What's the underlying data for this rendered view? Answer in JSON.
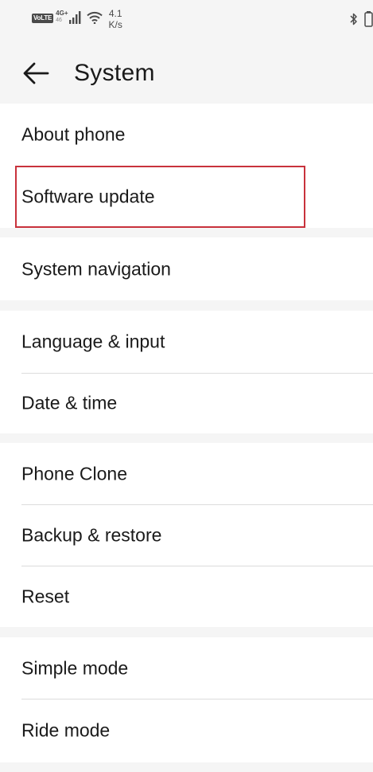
{
  "status_bar": {
    "volte": "VoLTE",
    "network": "4G",
    "network_plus": "+",
    "network_sub": "46",
    "speed_value": "4.1",
    "speed_unit": "K/s",
    "icons": [
      "signal-icon",
      "wifi-icon",
      "bluetooth-icon",
      "battery-icon"
    ]
  },
  "header": {
    "back_icon": "arrow-left-icon",
    "title": "System"
  },
  "groups": [
    {
      "items": [
        {
          "label": "About phone"
        },
        {
          "label": "Software update"
        }
      ]
    },
    {
      "items": [
        {
          "label": "System navigation"
        }
      ]
    },
    {
      "items": [
        {
          "label": "Language & input"
        },
        {
          "label": "Date & time"
        }
      ]
    },
    {
      "items": [
        {
          "label": "Phone Clone"
        },
        {
          "label": "Backup & restore"
        },
        {
          "label": "Reset"
        }
      ]
    },
    {
      "items": [
        {
          "label": "Simple mode"
        },
        {
          "label": "Ride mode"
        }
      ]
    }
  ],
  "highlight_color": "#c8323c"
}
